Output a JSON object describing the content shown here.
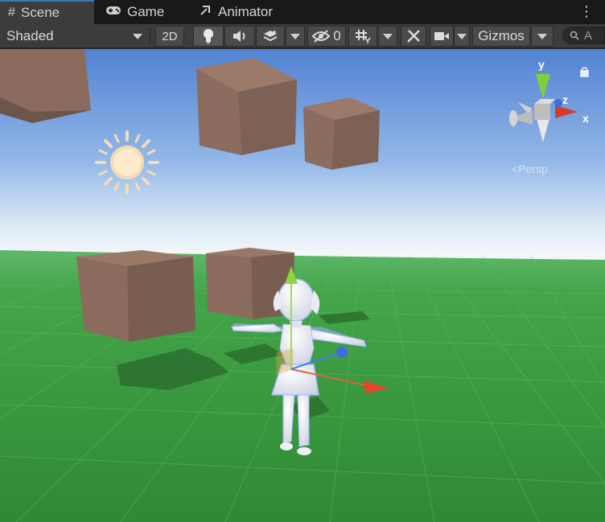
{
  "tabs": [
    {
      "label": "Scene",
      "icon": "scene-grid-icon",
      "active": true
    },
    {
      "label": "Game",
      "icon": "gamepad-icon",
      "active": false
    },
    {
      "label": "Animator",
      "icon": "animator-icon",
      "active": false
    }
  ],
  "toolbar": {
    "draw_mode": "Shaded",
    "toggle_2d": "2D",
    "hidden_count": "0",
    "gizmos_label": "Gizmos",
    "search_glyph": "A"
  },
  "gizmo": {
    "axis_x": "x",
    "axis_y": "y",
    "axis_z": "z",
    "projection": "<Persp"
  },
  "colors": {
    "accent_tab": "#3a79bb",
    "axis_x": "#d83a2a",
    "axis_y": "#7fd13b",
    "axis_z": "#3a6ee0",
    "ground": "#3e9a3e",
    "sky_top": "#4f7fd0"
  }
}
